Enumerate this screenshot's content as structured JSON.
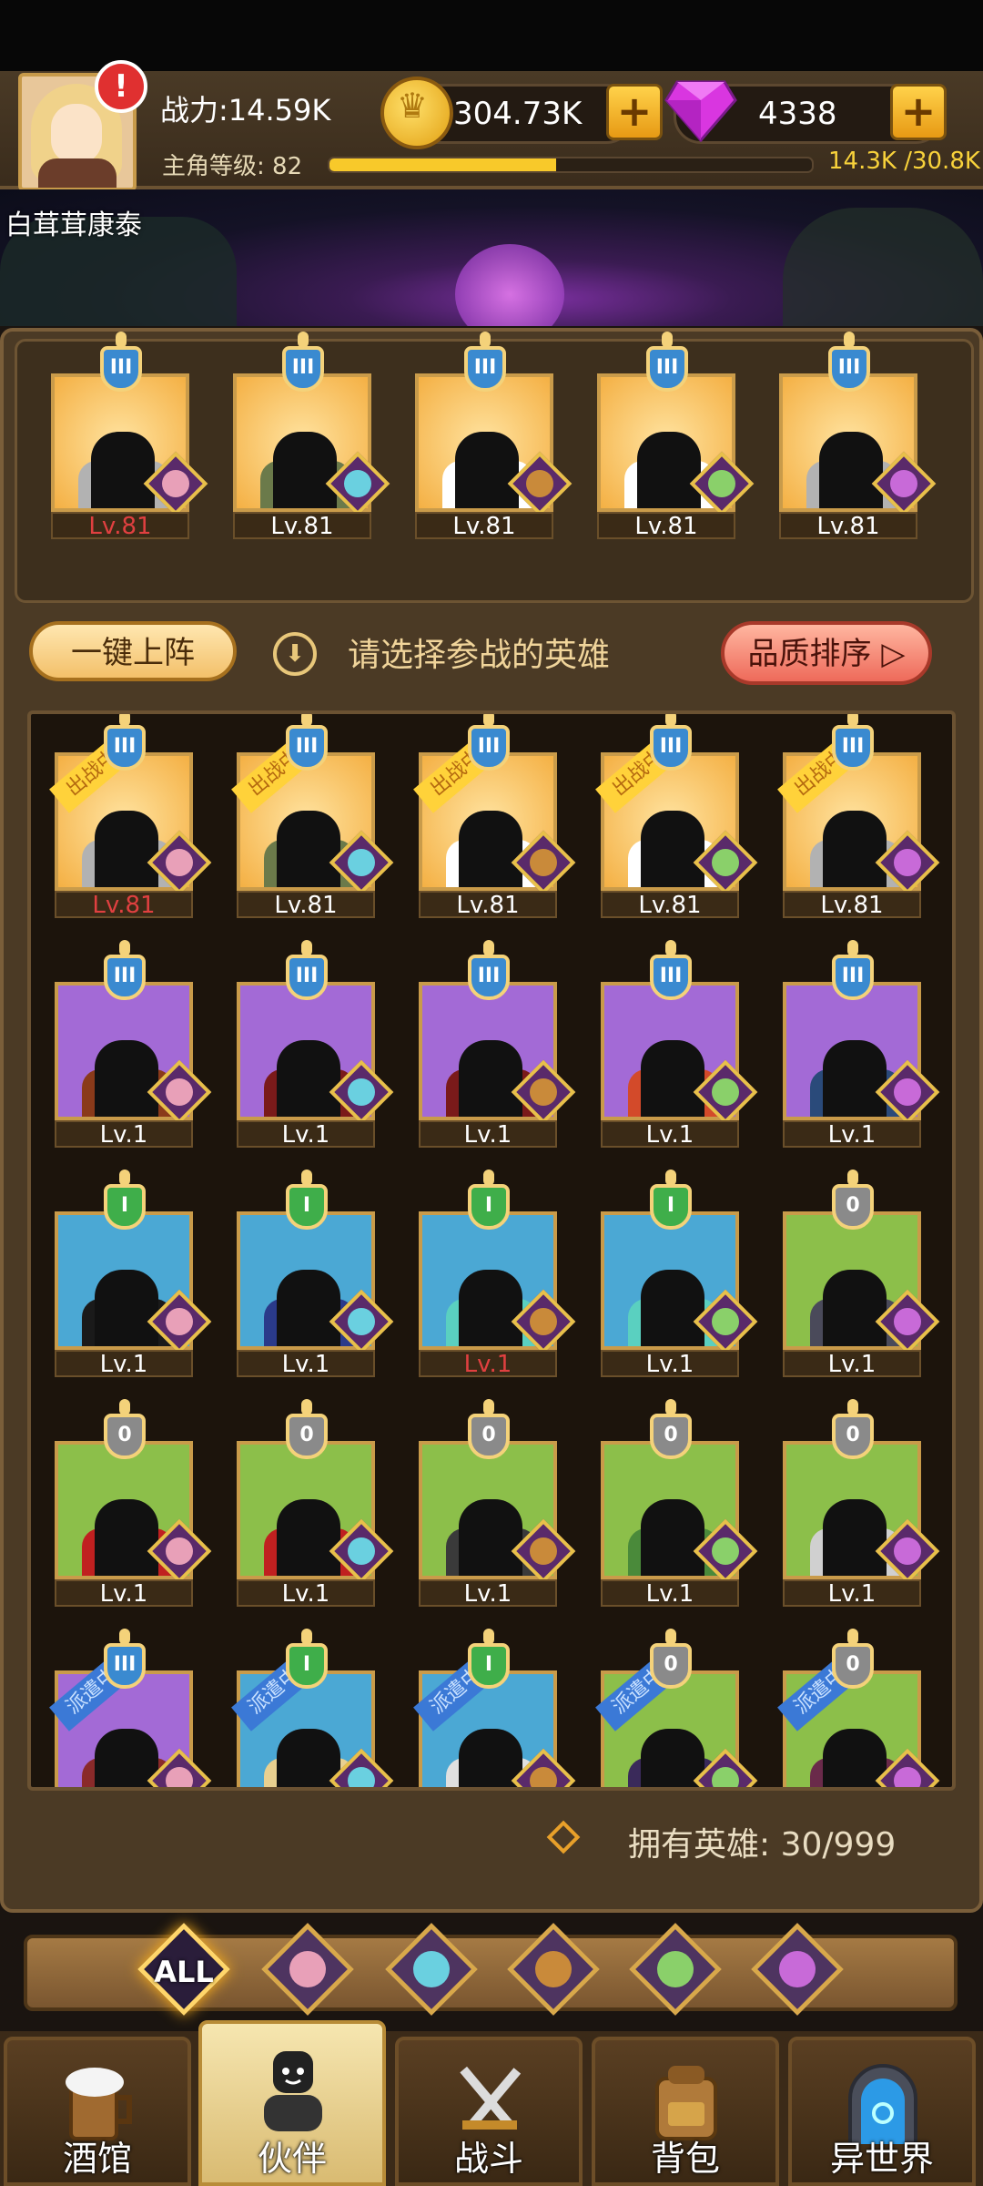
{
  "header": {
    "alert": "!",
    "power": "战力:14.59K",
    "level_text": "主角等级: 82",
    "xp_progress": 0.47,
    "xp_text": "14.3K /30.8K",
    "gold": "304.73K",
    "gems": "4338",
    "plus": "+"
  },
  "player_name": "白茸茸康泰",
  "team": [
    {
      "level": "Lv.81",
      "quality": "orange",
      "rank": "III",
      "red": true
    },
    {
      "level": "Lv.81",
      "quality": "orange",
      "rank": "III",
      "red": false
    },
    {
      "level": "Lv.81",
      "quality": "orange",
      "rank": "III",
      "red": false
    },
    {
      "level": "Lv.81",
      "quality": "orange",
      "rank": "III",
      "red": false
    },
    {
      "level": "Lv.81",
      "quality": "orange",
      "rank": "III",
      "red": false
    }
  ],
  "controls": {
    "one_key": "一键上阵",
    "hint": "请选择参战的英雄",
    "sort": "品质排序 ▷"
  },
  "heroes": [
    {
      "level": "Lv.81",
      "quality": "orange",
      "rank": "III",
      "tag": "出战中",
      "red": true
    },
    {
      "level": "Lv.81",
      "quality": "orange",
      "rank": "III",
      "tag": "出战中",
      "red": false
    },
    {
      "level": "Lv.81",
      "quality": "orange",
      "rank": "III",
      "tag": "出战中",
      "red": false
    },
    {
      "level": "Lv.81",
      "quality": "orange",
      "rank": "III",
      "tag": "出战中",
      "red": false
    },
    {
      "level": "Lv.81",
      "quality": "orange",
      "rank": "III",
      "tag": "出战中",
      "red": false
    },
    {
      "level": "Lv.1",
      "quality": "purple",
      "rank": "III",
      "tag": "",
      "red": false
    },
    {
      "level": "Lv.1",
      "quality": "purple",
      "rank": "III",
      "tag": "",
      "red": false
    },
    {
      "level": "Lv.1",
      "quality": "purple",
      "rank": "III",
      "tag": "",
      "red": false
    },
    {
      "level": "Lv.1",
      "quality": "purple",
      "rank": "III",
      "tag": "",
      "red": false
    },
    {
      "level": "Lv.1",
      "quality": "purple",
      "rank": "III",
      "tag": "",
      "red": false
    },
    {
      "level": "Lv.1",
      "quality": "blue",
      "rank": "I",
      "tag": "",
      "red": false
    },
    {
      "level": "Lv.1",
      "quality": "blue",
      "rank": "I",
      "tag": "",
      "red": false
    },
    {
      "level": "Lv.1",
      "quality": "blue",
      "rank": "I",
      "tag": "",
      "red": true
    },
    {
      "level": "Lv.1",
      "quality": "blue",
      "rank": "I",
      "tag": "",
      "red": false
    },
    {
      "level": "Lv.1",
      "quality": "green",
      "rank": "0",
      "tag": "",
      "red": false
    },
    {
      "level": "Lv.1",
      "quality": "green",
      "rank": "0",
      "tag": "",
      "red": false
    },
    {
      "level": "Lv.1",
      "quality": "green",
      "rank": "0",
      "tag": "",
      "red": false
    },
    {
      "level": "Lv.1",
      "quality": "green",
      "rank": "0",
      "tag": "",
      "red": false
    },
    {
      "level": "Lv.1",
      "quality": "green",
      "rank": "0",
      "tag": "",
      "red": false
    },
    {
      "level": "Lv.1",
      "quality": "green",
      "rank": "0",
      "tag": "",
      "red": false
    },
    {
      "level": "",
      "quality": "purple",
      "rank": "III",
      "tag": "派遣中",
      "red": false
    },
    {
      "level": "",
      "quality": "blue",
      "rank": "I",
      "tag": "派遣中",
      "red": false
    },
    {
      "level": "",
      "quality": "blue",
      "rank": "I",
      "tag": "派遣中",
      "red": false
    },
    {
      "level": "",
      "quality": "green",
      "rank": "0",
      "tag": "派遣中",
      "red": false
    },
    {
      "level": "",
      "quality": "green",
      "rank": "0",
      "tag": "派遣中",
      "red": false
    }
  ],
  "owned": "拥有英雄: 30/999",
  "filters": [
    {
      "name": "all",
      "label": "ALL",
      "active": true
    },
    {
      "name": "crown-faction",
      "label": "",
      "active": false,
      "color": "#e8a0b8"
    },
    {
      "name": "ocean-faction",
      "label": "",
      "active": false,
      "color": "#6ad0e0"
    },
    {
      "name": "lion-faction",
      "label": "",
      "active": false,
      "color": "#c98a3a"
    },
    {
      "name": "elf-faction",
      "label": "",
      "active": false,
      "color": "#8ad06a"
    },
    {
      "name": "demon-faction",
      "label": "",
      "active": false,
      "color": "#c86ad8"
    }
  ],
  "nav": [
    {
      "name": "tavern",
      "label": "酒馆",
      "active": false
    },
    {
      "name": "partner",
      "label": "伙伴",
      "active": true
    },
    {
      "name": "battle",
      "label": "战斗",
      "active": false
    },
    {
      "name": "backpack",
      "label": "背包",
      "active": false
    },
    {
      "name": "other-world",
      "label": "异世界",
      "active": false
    }
  ]
}
